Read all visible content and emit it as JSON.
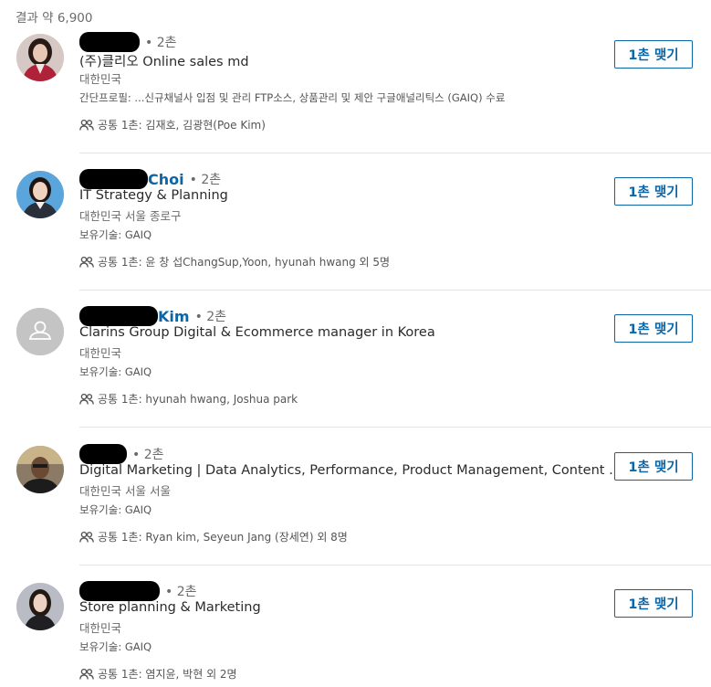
{
  "results_count": "결과 약 6,900",
  "results": [
    {
      "name": "",
      "degree": "• 2촌",
      "headline": "(주)클리오 Online sales md",
      "location": "대한민국",
      "snippet": "간단프로필: ...신규채널사 입점 및 관리 FTP소스, 상품관리 및 제안 구글애널리틱스 (GAIQ) 수료",
      "mutual": "공통 1촌: 김재호, 김광현(Poe Kim)",
      "connect_label": "1촌 맺기",
      "avatar": "photo-woman-red-blazer"
    },
    {
      "name": "Choi",
      "degree": "• 2촌",
      "headline": "IT Strategy & Planning",
      "location": "대한민국 서울 종로구",
      "snippet": "보유기술: GAIQ",
      "mutual": "공통 1촌: 윤 창 섭ChangSup,Yoon, hyunah hwang 외 5명",
      "connect_label": "1촌 맺기",
      "avatar": "photo-woman-blue-background"
    },
    {
      "name": "Kim",
      "degree": "• 2촌",
      "headline": "Clarins Group Digital & Ecommerce manager in Korea",
      "location": "대한민국",
      "snippet": "보유기술: GAIQ",
      "mutual": "공통 1촌: hyunah hwang, Joshua park",
      "connect_label": "1촌 맺기",
      "avatar": "default-person-icon"
    },
    {
      "name": "",
      "degree": "• 2촌",
      "headline": "Digital Marketing | Data Analytics, Performance, Product Management, Content ...",
      "location": "대한민국 서울 서울",
      "snippet": "보유기술: GAIQ",
      "mutual": "공통 1촌: Ryan kim, Seyeun Jang (장세연) 외 8명",
      "connect_label": "1촌 맺기",
      "avatar": "photo-man-dark"
    },
    {
      "name": "",
      "degree": "• 2촌",
      "headline": "Store planning & Marketing",
      "location": "대한민국",
      "snippet": "보유기술: GAIQ",
      "mutual": "공통 1촌: 염지윤, 박현 외 2명",
      "connect_label": "1촌 맺기",
      "avatar": "photo-woman-grey"
    }
  ],
  "colors": {
    "link_blue": "#0b66a8",
    "muted_text": "#6b6b6b",
    "separator": "#e3e3e3"
  }
}
